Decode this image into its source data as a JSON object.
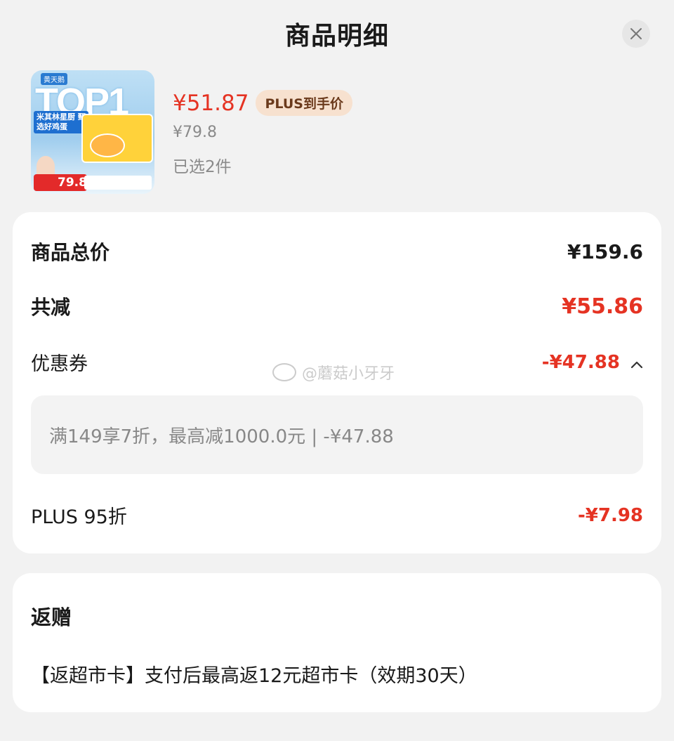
{
  "header": {
    "title": "商品明细"
  },
  "product": {
    "price_now": "¥51.87",
    "plus_tag": "PLUS到手价",
    "price_original": "¥79.8",
    "quantity_text": "已选2件",
    "thumbnail": {
      "top_text": "TOP1",
      "tagline": "米其林星厨 甄选好鸡蛋",
      "badge_price": "79.8"
    }
  },
  "summary": {
    "total_label": "商品总价",
    "total_value": "¥159.6",
    "reduction_label": "共减",
    "reduction_value": "¥55.86",
    "coupon_label": "优惠券",
    "coupon_value": "-¥47.88",
    "coupon_detail": "满149享7折，最高减1000.0元 | -¥47.88",
    "plus_label": "PLUS 95折",
    "plus_value": "-¥7.98"
  },
  "gift": {
    "title": "返赠",
    "text": "【返超市卡】支付后最高返12元超市卡（效期30天）"
  },
  "watermark": "@蘑菇小牙牙",
  "colors": {
    "accent_red": "#e53323",
    "plus_tag_bg": "#f7e1cf",
    "plus_tag_text": "#6b3a1c"
  }
}
